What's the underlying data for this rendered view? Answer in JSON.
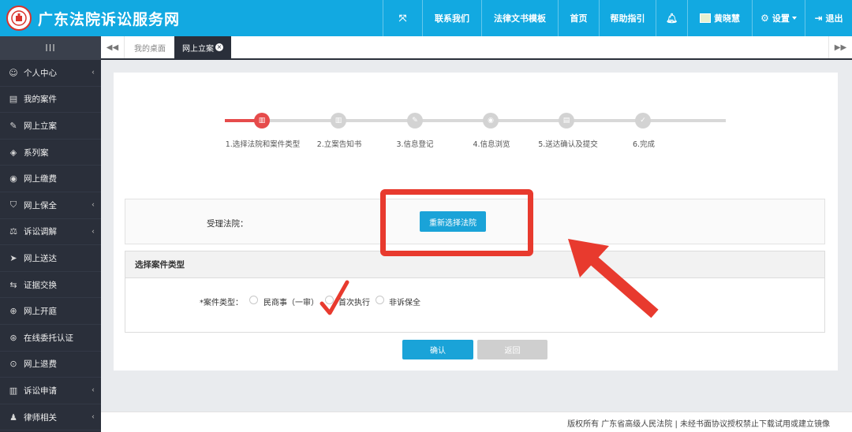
{
  "header": {
    "title": "广东法院诉讼服务网",
    "nav": [
      {
        "label": "",
        "icon": "fullscreen-icon"
      },
      {
        "label": "联系我们"
      },
      {
        "label": "法律文书模板"
      },
      {
        "label": "首页"
      },
      {
        "label": "帮助指引"
      },
      {
        "label": "",
        "icon": "bell-icon"
      },
      {
        "label": "黄晓慧",
        "icon": "user-avatar"
      },
      {
        "label": "设置",
        "icon": "gear-icon"
      },
      {
        "label": "退出",
        "icon": "logout-icon"
      }
    ],
    "accent_color": "#12a9e1"
  },
  "sidebar": {
    "toggle_label": "III",
    "items": [
      {
        "label": "个人中心",
        "icon": "user-icon",
        "has_arrow": true
      },
      {
        "label": "我的案件",
        "icon": "file-icon",
        "has_arrow": false
      },
      {
        "label": "网上立案",
        "icon": "edit-icon",
        "has_arrow": false
      },
      {
        "label": "系列案",
        "icon": "layers-icon",
        "has_arrow": false
      },
      {
        "label": "网上缴费",
        "icon": "pay-icon",
        "has_arrow": false
      },
      {
        "label": "网上保全",
        "icon": "shield-icon",
        "has_arrow": true
      },
      {
        "label": "诉讼调解",
        "icon": "mediate-icon",
        "has_arrow": true
      },
      {
        "label": "网上送达",
        "icon": "send-icon",
        "has_arrow": false
      },
      {
        "label": "证据交换",
        "icon": "exchange-icon",
        "has_arrow": false
      },
      {
        "label": "网上开庭",
        "icon": "court-icon",
        "has_arrow": false
      },
      {
        "label": "在线委托认证",
        "icon": "globe-icon",
        "has_arrow": false
      },
      {
        "label": "网上退费",
        "icon": "refund-icon",
        "has_arrow": false
      },
      {
        "label": "诉讼申请",
        "icon": "apply-icon",
        "has_arrow": true
      },
      {
        "label": "律师相关",
        "icon": "lawyer-icon",
        "has_arrow": true
      }
    ]
  },
  "tabs": [
    {
      "label": "我的桌面",
      "active": false
    },
    {
      "label": "网上立案",
      "active": true
    }
  ],
  "steps": [
    {
      "label": "1.选择法院和案件类型",
      "active": true
    },
    {
      "label": "2.立案告知书",
      "active": false
    },
    {
      "label": "3.信息登记",
      "active": false
    },
    {
      "label": "4.信息浏览",
      "active": false
    },
    {
      "label": "5.送达确认及提交",
      "active": false
    },
    {
      "label": "6.完成",
      "active": false
    }
  ],
  "court": {
    "label": "受理法院：",
    "button": "重新选择法院"
  },
  "case_type": {
    "section_title": "选择案件类型",
    "label": "*案件类型：",
    "options": [
      "民商事（一审）",
      "首次执行",
      "非诉保全"
    ]
  },
  "actions": {
    "confirm": "确认",
    "back": "返回"
  },
  "footer": {
    "copyright": "版权所有 广东省高级人民法院 | 未经书面协议授权禁止下载试用或建立镜像"
  },
  "annotation_color": "#e83a2e"
}
